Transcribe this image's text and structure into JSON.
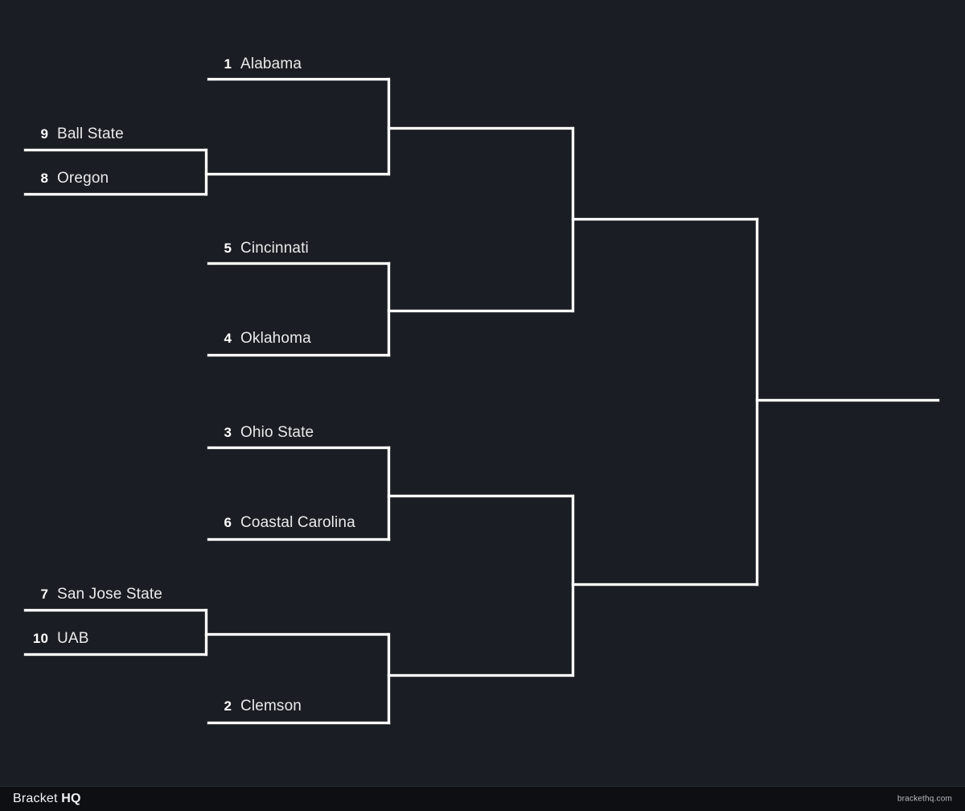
{
  "brand": {
    "prefix": "Bracket ",
    "bold": "HQ",
    "site": "brackethq.com"
  },
  "colors": {
    "background": "#1a1d23",
    "line": "#ffffff",
    "footer_bg": "#0d0f13",
    "team_text": "#e9eaec",
    "seed_text": "#ffffff"
  },
  "bracket": {
    "title": "Bracket HQ",
    "rounds": 4,
    "matchups": [
      {
        "id": "r1-m1",
        "teams": [
          {
            "seed": "1",
            "name": "Alabama"
          }
        ]
      },
      {
        "id": "r1-m2",
        "teams": [
          {
            "seed": "9",
            "name": "Ball State"
          },
          {
            "seed": "8",
            "name": "Oregon"
          }
        ]
      },
      {
        "id": "r1-m3",
        "teams": [
          {
            "seed": "5",
            "name": "Cincinnati"
          },
          {
            "seed": "4",
            "name": "Oklahoma"
          }
        ]
      },
      {
        "id": "r1-m4",
        "teams": [
          {
            "seed": "3",
            "name": "Ohio State"
          },
          {
            "seed": "6",
            "name": "Coastal Carolina"
          }
        ]
      },
      {
        "id": "r1-m5",
        "teams": [
          {
            "seed": "7",
            "name": "San Jose State"
          },
          {
            "seed": "10",
            "name": "UAB"
          }
        ]
      },
      {
        "id": "r1-m6",
        "teams": [
          {
            "seed": "2",
            "name": "Clemson"
          }
        ]
      }
    ],
    "teams": {
      "alabama": {
        "seed": "1",
        "name": "Alabama"
      },
      "ball_state": {
        "seed": "9",
        "name": "Ball State"
      },
      "oregon": {
        "seed": "8",
        "name": "Oregon"
      },
      "cincinnati": {
        "seed": "5",
        "name": "Cincinnati"
      },
      "oklahoma": {
        "seed": "4",
        "name": "Oklahoma"
      },
      "ohio_state": {
        "seed": "3",
        "name": "Ohio State"
      },
      "coastal_carolina": {
        "seed": "6",
        "name": "Coastal Carolina"
      },
      "san_jose_state": {
        "seed": "7",
        "name": "San Jose State"
      },
      "uab": {
        "seed": "10",
        "name": "UAB"
      },
      "clemson": {
        "seed": "2",
        "name": "Clemson"
      }
    }
  }
}
